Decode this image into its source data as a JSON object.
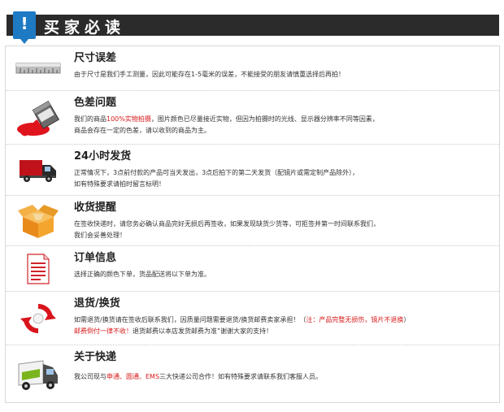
{
  "header": {
    "badge": "!",
    "title": "买家必读"
  },
  "rows": [
    {
      "icon": "ruler-icon",
      "title": "尺寸误差",
      "line1": [
        {
          "t": "由于尺寸是我们手工测量，因此可能存在1-5毫米的误差，不能接受的朋友请慎重选择后再拍！",
          "c": "normal"
        }
      ]
    },
    {
      "icon": "paint-bucket-icon",
      "title": "色差问题",
      "line1": [
        {
          "t": "我们的商品",
          "c": "normal"
        },
        {
          "t": "100%实物拍摄",
          "c": "red"
        },
        {
          "t": "，图片颜色已尽量接近实物，但因为拍摄时的光线、显示器分辨率不同等因素，",
          "c": "normal"
        }
      ],
      "line2": [
        {
          "t": "商品会存在一定的色差，请以收到的商品为主。",
          "c": "normal"
        }
      ]
    },
    {
      "icon": "delivery-truck-icon",
      "title": "24小时发货",
      "line1": [
        {
          "t": "正常情况下，3点前付款的产品可当天发出，3点后拍下的第二天发货（配镜片或需定制产品除外），",
          "c": "normal"
        }
      ],
      "line2": [
        {
          "t": "如有特殊要求请拍时留言标明！",
          "c": "normal"
        }
      ]
    },
    {
      "icon": "package-box-icon",
      "title": "收货提醒",
      "line1": [
        {
          "t": "在签收快递时，请您务必确认商品完好无损后再签收，如果发现缺货少货等，可拒签并第一时间联系我们，",
          "c": "normal"
        }
      ],
      "line2": [
        {
          "t": "我们会妥善处理！",
          "c": "normal"
        }
      ]
    },
    {
      "icon": "document-icon",
      "title": "订单信息",
      "line1": [
        {
          "t": "选择正确的颜色下单，货品配送将以下单为准。",
          "c": "normal"
        }
      ]
    },
    {
      "icon": "return-arrows-icon",
      "title": "退货/换货",
      "line1": [
        {
          "t": "如需退货/换货请在签收后联系我们，因质量问题需要退货/换货邮费卖家承担！（",
          "c": "normal"
        },
        {
          "t": "注：产品完整无损伤，镜片不退换",
          "c": "red"
        },
        {
          "t": "）",
          "c": "normal"
        }
      ],
      "line2": [
        {
          "t": "邮费倒付一律不收！",
          "c": "red"
        },
        {
          "t": "退货邮费以本店发货邮费为准”谢谢大家的支持！",
          "c": "normal"
        }
      ]
    },
    {
      "icon": "courier-van-icon",
      "title": "关于快递",
      "line1": [
        {
          "t": "我公司现与",
          "c": "normal"
        },
        {
          "t": "申通、圆通、EMS",
          "c": "red"
        },
        {
          "t": "三大快递公司合作！如有特殊要求请联系我们客服人员。",
          "c": "normal"
        }
      ]
    }
  ]
}
